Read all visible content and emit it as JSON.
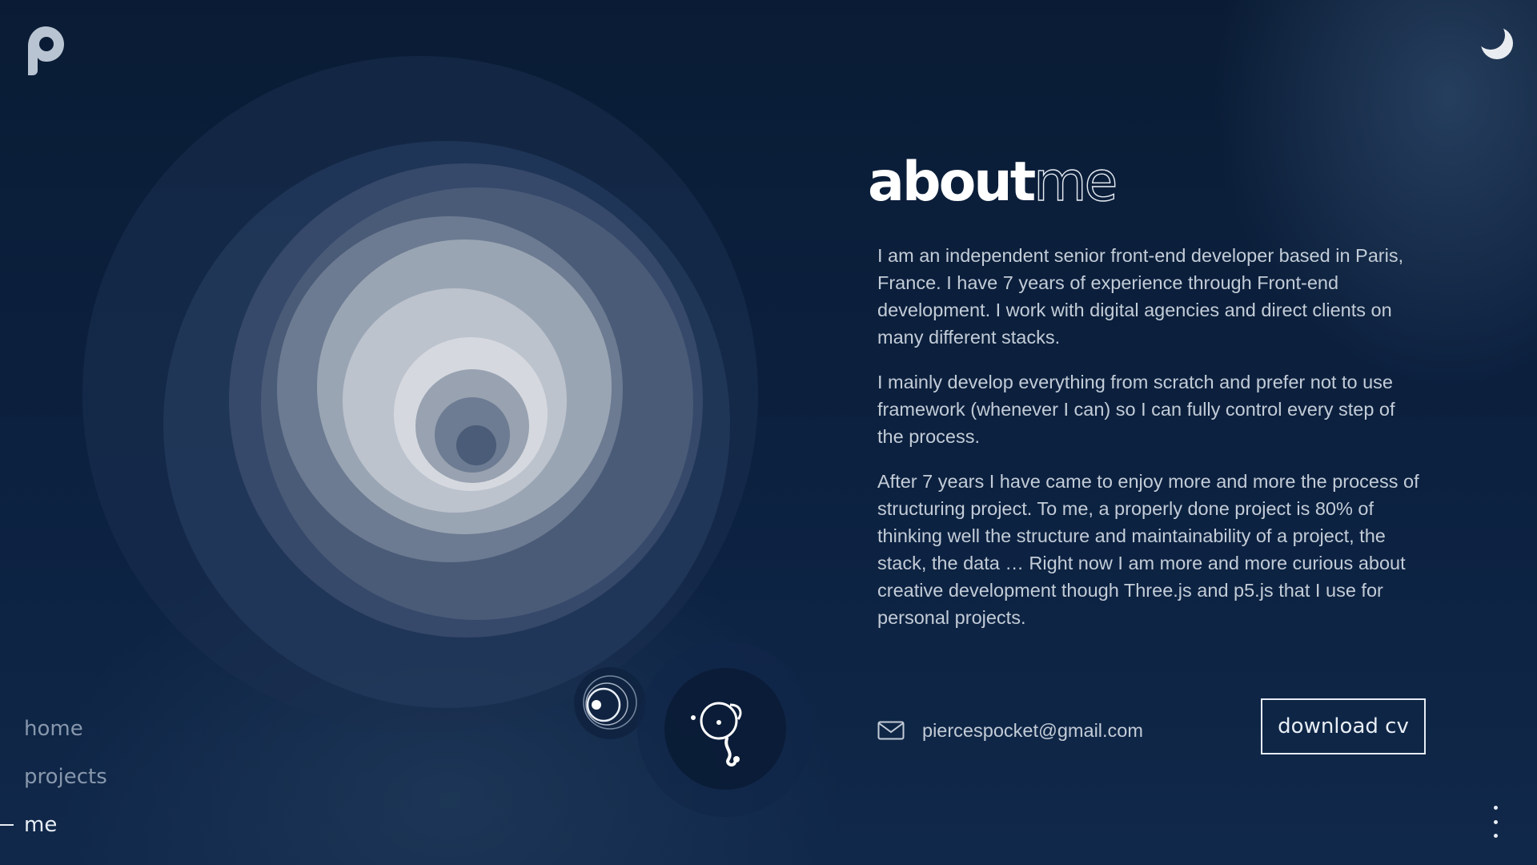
{
  "header": {
    "logo_icon": "p-logo-icon",
    "theme_toggle_icon": "moon-icon"
  },
  "about": {
    "title_bold": "about",
    "title_outline": "me",
    "paragraphs": [
      "I am an independent senior front-end developer based in Paris, France. I have 7 years of experience through Front-end development. I work with digital agencies and direct clients on many different stacks.",
      "I mainly develop everything from scratch and prefer not to use framework (whenever I can) so I can fully control every step of the process.",
      "After 7 years I have came to enjoy more and more the process of structuring project. To me, a properly done project is 80% of thinking well the structure and maintainability of a project, the stack, the data … Right now I am more and more curious about creative development though Three.js and p5.js that I use for personal projects."
    ]
  },
  "contact": {
    "email_icon": "mail-icon",
    "email": "piercespocket@gmail.com",
    "download_label": "download cv"
  },
  "nav": {
    "items": [
      {
        "label": "home",
        "active": false
      },
      {
        "label": "projects",
        "active": false
      },
      {
        "label": "me",
        "active": true
      }
    ]
  },
  "footer": {
    "more_icon": "vertical-dots-icon"
  },
  "colors": {
    "background": "#0a1c35",
    "text": "#c3ccd7",
    "heading": "#ffffff",
    "nav_inactive": "#8797ac"
  }
}
